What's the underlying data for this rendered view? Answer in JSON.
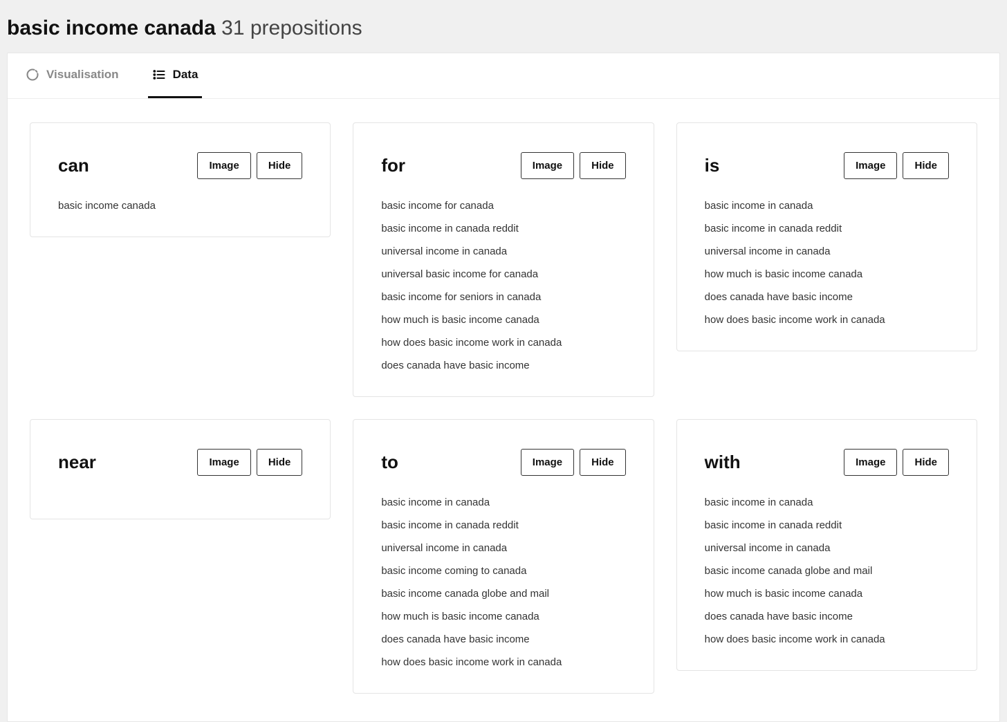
{
  "header": {
    "title_bold": "basic income canada",
    "title_rest": "31 prepositions"
  },
  "tabs": {
    "visualisation": {
      "label": "Visualisation"
    },
    "data": {
      "label": "Data"
    }
  },
  "buttons": {
    "image": "Image",
    "hide": "Hide"
  },
  "cards": [
    {
      "key": "can",
      "title": "can",
      "items": [
        "basic income canada"
      ]
    },
    {
      "key": "for",
      "title": "for",
      "items": [
        "basic income for canada",
        "basic income in canada reddit",
        "universal income in canada",
        "universal basic income for canada",
        "basic income for seniors in canada",
        "how much is basic income canada",
        "how does basic income work in canada",
        "does canada have basic income"
      ]
    },
    {
      "key": "is",
      "title": "is",
      "items": [
        "basic income in canada",
        "basic income in canada reddit",
        "universal income in canada",
        "how much is basic income canada",
        "does canada have basic income",
        "how does basic income work in canada"
      ]
    },
    {
      "key": "near",
      "title": "near",
      "items": []
    },
    {
      "key": "to",
      "title": "to",
      "items": [
        "basic income in canada",
        "basic income in canada reddit",
        "universal income in canada",
        "basic income coming to canada",
        "basic income canada globe and mail",
        "how much is basic income canada",
        "does canada have basic income",
        "how does basic income work in canada"
      ]
    },
    {
      "key": "with",
      "title": "with",
      "items": [
        "basic income in canada",
        "basic income in canada reddit",
        "universal income in canada",
        "basic income canada globe and mail",
        "how much is basic income canada",
        "does canada have basic income",
        "how does basic income work in canada"
      ]
    }
  ]
}
